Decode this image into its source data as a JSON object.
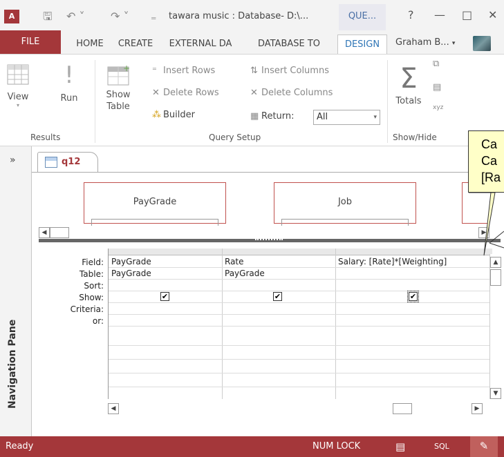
{
  "titlebar": {
    "app_logo": "A",
    "title": "tawara music : Database- D:\\...",
    "context_tab": "QUE...",
    "help": "?",
    "minimize": "—",
    "restore": "□",
    "close": "✕"
  },
  "tabs": [
    {
      "label": "FILE"
    },
    {
      "label": "HOME"
    },
    {
      "label": "CREATE"
    },
    {
      "label": "EXTERNAL DA"
    },
    {
      "label": "DATABASE TO"
    },
    {
      "label": "DESIGN"
    }
  ],
  "user": "Graham B...",
  "ribbon": {
    "results": {
      "label": "Results",
      "view": "View",
      "run": "Run"
    },
    "query_setup": {
      "label": "Query Setup",
      "show_table_1": "Show",
      "show_table_2": "Table",
      "insert_rows": "Insert Rows",
      "delete_rows": "Delete Rows",
      "builder": "Builder",
      "insert_columns": "Insert Columns",
      "delete_columns": "Delete Columns",
      "return_label": "Return:",
      "return_value": "All"
    },
    "show_hide": {
      "label": "Show/Hide",
      "totals": "Totals"
    }
  },
  "nav": {
    "label": "Navigation Pane",
    "chevron": "»"
  },
  "doc_tab": {
    "label": "q12"
  },
  "tables": [
    {
      "name": "PayGrade"
    },
    {
      "name": "Job"
    }
  ],
  "grid": {
    "row_labels": [
      "Field:",
      "Table:",
      "Sort:",
      "Show:",
      "Criteria:",
      "or:"
    ],
    "columns": [
      {
        "field": "PayGrade",
        "table": "PayGrade",
        "show": "✔"
      },
      {
        "field": "Rate",
        "table": "PayGrade",
        "show": "✔"
      },
      {
        "field": "Salary: [Rate]*[Weighting]",
        "table": "",
        "show": "✔"
      }
    ]
  },
  "callout": {
    "line1": "Ca",
    "line2": "Ca",
    "line3": "[Ra"
  },
  "status": {
    "ready": "Ready",
    "numlock": "NUM LOCK",
    "sql": "SQL"
  }
}
